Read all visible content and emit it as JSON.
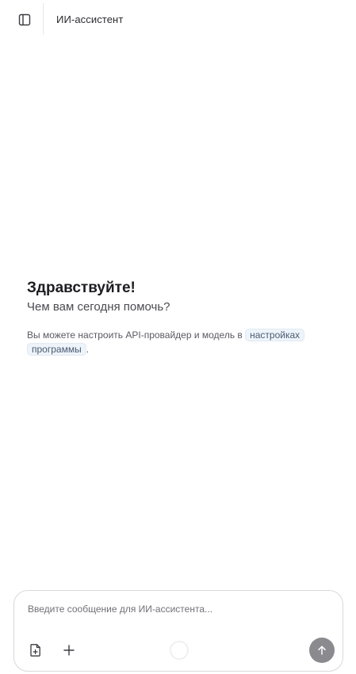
{
  "header": {
    "title": "ИИ-ассистент",
    "sidebar_toggle_icon": "sidebar-panel-icon"
  },
  "welcome": {
    "title": "Здравствуйте!",
    "subtitle": "Чем вам сегодня помочь?",
    "note_prefix": "Вы можете настроить API-провайдер и модель в ",
    "settings_link": "настройках программы",
    "note_suffix": "."
  },
  "composer": {
    "placeholder": "Введите сообщение для ИИ-ассистента...",
    "value": "",
    "attach_icon": "file-plus-icon",
    "add_icon": "plus-icon",
    "send_icon": "arrow-up-icon"
  },
  "colors": {
    "send_button": "#8a8a8f",
    "link_background": "#eef4fb",
    "border": "#d9d9de"
  }
}
